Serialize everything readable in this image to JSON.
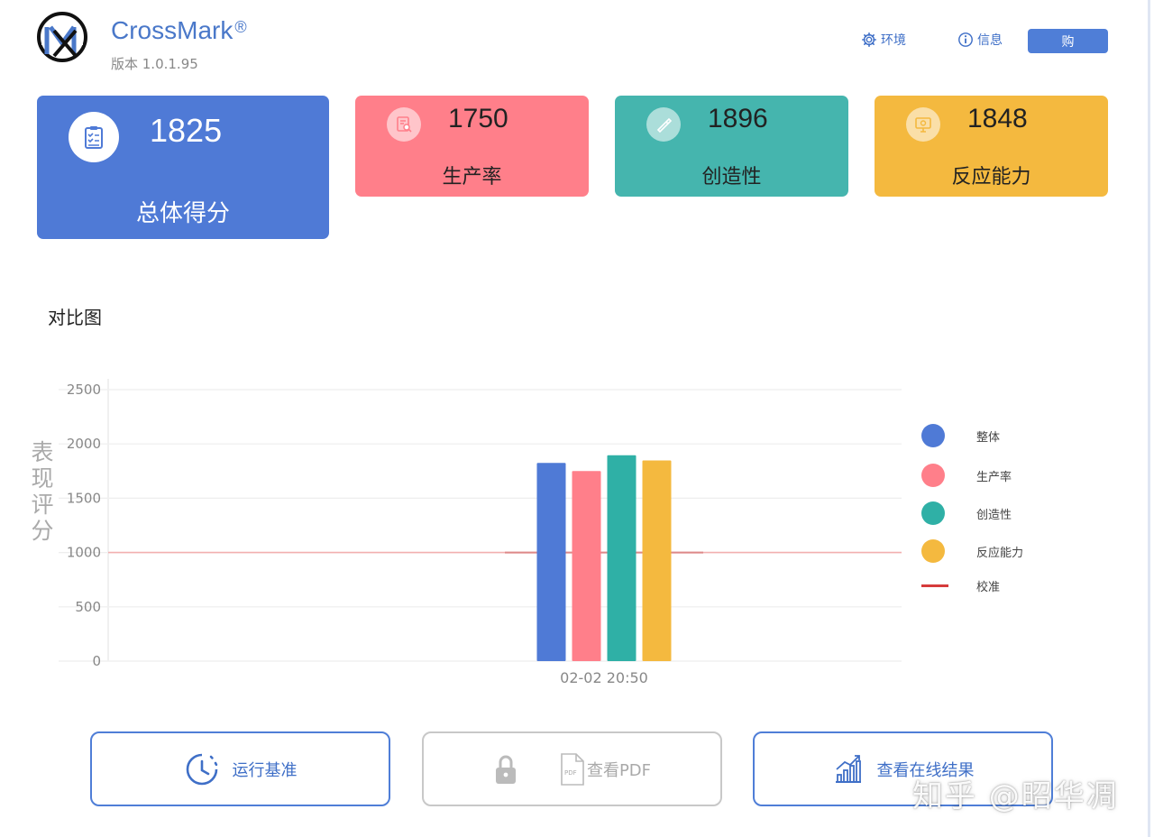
{
  "app": {
    "name": "CrossMark",
    "registered": "®",
    "version": "版本 1.0.1.95"
  },
  "header": {
    "env_label": "环境",
    "info_label": "信息",
    "buy_label": "购"
  },
  "cards": {
    "total": {
      "score": "1825",
      "label": "总体得分",
      "icon": "clipboard-checklist-icon"
    },
    "productivity": {
      "score": "1750",
      "label": "生产率",
      "icon": "document-search-icon",
      "color": "#ff7f8a"
    },
    "creativity": {
      "score": "1896",
      "label": "创造性",
      "icon": "brush-icon",
      "color": "#45b5ae"
    },
    "responsiveness": {
      "score": "1848",
      "label": "反应能力",
      "icon": "monitor-icon",
      "color": "#f4b93f"
    }
  },
  "section_title": "对比图",
  "chart_data": {
    "type": "bar",
    "categories": [
      "02-02 20:50"
    ],
    "series": [
      {
        "name": "整体",
        "values": [
          1825
        ],
        "color": "#4f7ad6"
      },
      {
        "name": "生产率",
        "values": [
          1750
        ],
        "color": "#ff7f8a"
      },
      {
        "name": "创造性",
        "values": [
          1896
        ],
        "color": "#2fb0a6"
      },
      {
        "name": "反应能力",
        "values": [
          1848
        ],
        "color": "#f4b93f"
      }
    ],
    "reference_line": {
      "name": "校准",
      "value": 1000,
      "color": "#d63b3b"
    },
    "ylabel": "表现评分",
    "ylim": [
      0,
      2500
    ],
    "yticks": [
      0,
      500,
      1000,
      1500,
      2000,
      2500
    ],
    "grid": true,
    "legend_position": "right"
  },
  "buttons": {
    "run": "运行基准",
    "pdf": "查看PDF",
    "online": "查看在线结果"
  },
  "watermark": "知乎 @昭华凋"
}
